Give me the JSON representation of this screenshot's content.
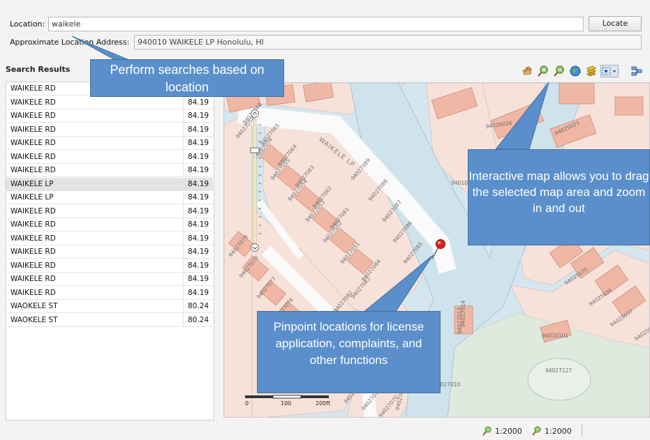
{
  "location": {
    "label": "Location:",
    "value": "waikele",
    "locate_button": "Locate"
  },
  "approx": {
    "label": "Approximate Location Address:",
    "value": "940010 WAIKELE LP  Honolulu, HI"
  },
  "results": {
    "title": "Search Results",
    "rows": [
      {
        "street": "WAIKELE RD",
        "score": "84.19"
      },
      {
        "street": "WAIKELE RD",
        "score": "84.19"
      },
      {
        "street": "WAIKELE RD",
        "score": "84.19"
      },
      {
        "street": "WAIKELE RD",
        "score": "84.19"
      },
      {
        "street": "WAIKELE RD",
        "score": "84.19"
      },
      {
        "street": "WAIKELE RD",
        "score": "84.19"
      },
      {
        "street": "WAIKELE RD",
        "score": "84.19"
      },
      {
        "street": "WAIKELE LP",
        "score": "84.19"
      },
      {
        "street": "WAIKELE LP",
        "score": "84.19"
      },
      {
        "street": "WAIKELE RD",
        "score": "84.19"
      },
      {
        "street": "WAIKELE RD",
        "score": "84.19"
      },
      {
        "street": "WAIKELE RD",
        "score": "84.19"
      },
      {
        "street": "WAIKELE RD",
        "score": "84.19"
      },
      {
        "street": "WAIKELE RD",
        "score": "84.19"
      },
      {
        "street": "WAIKELE RD",
        "score": "84.19"
      },
      {
        "street": "WAIKELE RD",
        "score": "84.19"
      },
      {
        "street": "WAOKELE ST",
        "score": "80.24"
      },
      {
        "street": "WAOKELE ST",
        "score": "80.24"
      }
    ],
    "selected_index": 7
  },
  "toolbar": {
    "icons": [
      "pan-hand-icon",
      "zoom-in-icon",
      "zoom-out-icon",
      "globe-icon",
      "layers-icon",
      "select-dropdown-icon",
      "legend-icon"
    ]
  },
  "map": {
    "street_label": "WAIKELE LP",
    "parcels": [
      "94027058",
      "94027056",
      "94027055",
      "94027054",
      "94027053",
      "94027052",
      "94027051",
      "94027066",
      "94027065",
      "94027064",
      "94027063",
      "94027062",
      "94027061",
      "94027079",
      "94027078",
      "94027077",
      "94027076",
      "94027075",
      "94027074",
      "94027073",
      "94027072",
      "94027071",
      "94027070",
      "94027089",
      "94027088",
      "94027087",
      "94027086",
      "94027085",
      "94027084",
      "94027083",
      "94027082",
      "94027081",
      "94027080",
      "94026026",
      "94025023",
      "94025035",
      "94025036",
      "94025037",
      "94025038",
      "94025021",
      "94027010",
      "94010101",
      "94027127",
      "940101",
      "94027013",
      "94027014",
      "9402710",
      "94027012"
    ],
    "scale_labels": [
      "0",
      "100",
      "200ft"
    ]
  },
  "status": {
    "scale1": "1:2000",
    "scale2": "1:2000"
  },
  "callouts": {
    "search": "Perform searches based on location",
    "map": "Interactive map allows you to drag the selected map area and zoom in and out",
    "pin": "Pinpoint locations for license application, complaints, and other functions"
  },
  "colors": {
    "callout_fill": "#5b8fcb",
    "callout_border": "#41719c",
    "water": "#d6e6ee",
    "parcel": "#f7e2da",
    "building": "#f0b7a4",
    "park": "#dfeadf",
    "pin": "#d8231f"
  }
}
